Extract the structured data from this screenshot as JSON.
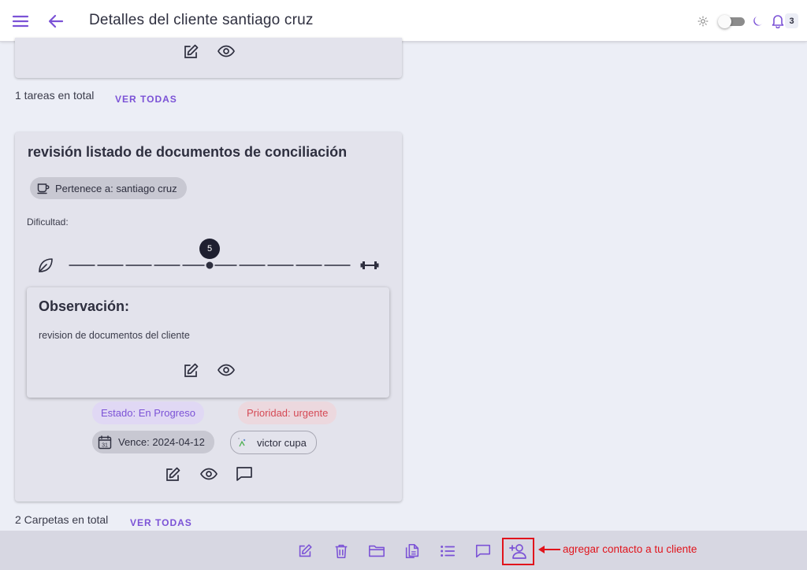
{
  "appbar": {
    "title": "Detalles del cliente santiago cruz",
    "notifications_count": "3",
    "icons": [
      "menu-icon",
      "back-arrow-icon",
      "sun-icon",
      "moon-icon",
      "bell-icon"
    ]
  },
  "tasks_section": {
    "summary": "1 tareas en total",
    "view_all": "VER TODAS"
  },
  "task_card": {
    "title": "revisión listado de documentos de conciliación",
    "belongs_to": "Pertenece a: santiago cruz",
    "difficulty_label": "Dificultad:",
    "difficulty_value": "5",
    "difficulty_min": 0,
    "difficulty_max": 10,
    "observation_title": "Observación:",
    "observation_text": "revision de documentos del cliente",
    "status": "Estado: En Progreso",
    "priority": "Prioridad: urgente",
    "due": "Vence: 2024-04-12",
    "assignee": "victor cupa",
    "calendar_day": "31"
  },
  "folders_section": {
    "summary": "2 Carpetas en total",
    "view_all": "VER TODAS"
  },
  "bottom_bar": {
    "icons": [
      "edit-icon",
      "delete-icon",
      "folder-icon",
      "documents-icon",
      "list-icon",
      "comment-icon",
      "add-contact-icon"
    ]
  },
  "annotation": {
    "text": "agregar contacto a tu cliente",
    "color": "#e1141c"
  },
  "colors": {
    "accent": "#7b52d6",
    "priority": "#d54a55",
    "card_bg": "#e3e3ec",
    "page_bg": "#eceef6"
  }
}
